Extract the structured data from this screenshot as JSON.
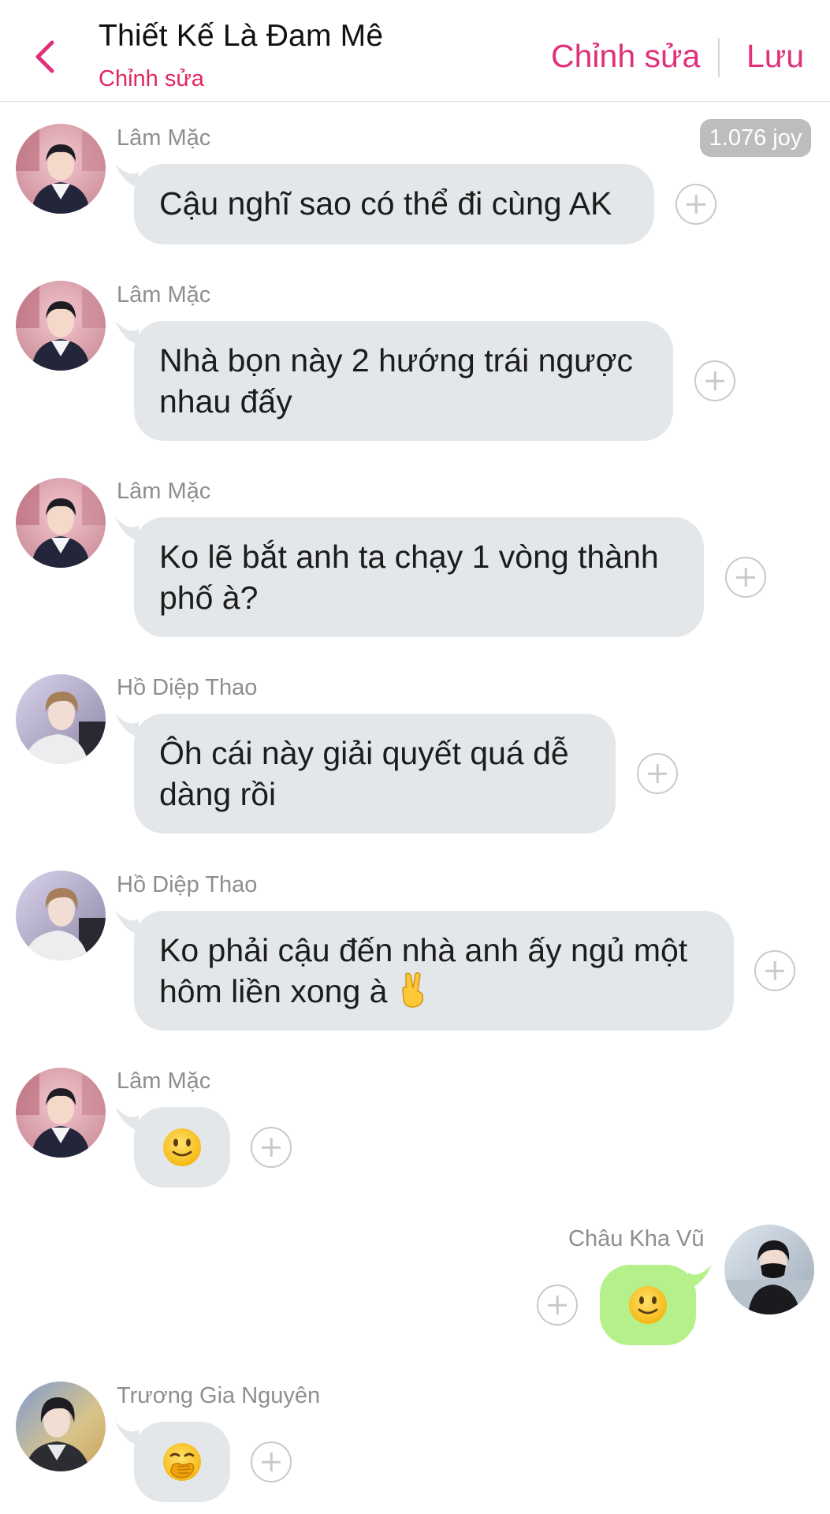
{
  "header": {
    "title": "Thiết Kế Là Đam Mê",
    "subtitle": "Chỉnh sửa",
    "edit_label": "Chỉnh sửa",
    "save_label": "Lưu",
    "back_icon": "chevron-left-icon"
  },
  "coin_badge": "1.076 joy",
  "colors": {
    "accent": "#e0307a",
    "subtitle": "#e0285e",
    "bubble_gray": "#e4e7ea",
    "bubble_green": "#b6f08a"
  },
  "messages": [
    {
      "sender": "Lâm Mặc",
      "text": "Cậu nghĩ sao có thể đi cùng AK"
    },
    {
      "sender": "Lâm Mặc",
      "text": "Nhà bọn này 2 hướng trái ngược nhau đấy"
    },
    {
      "sender": "Lâm Mặc",
      "text": "Ko lẽ bắt anh ta chạy 1 vòng thành phố à?"
    },
    {
      "sender": "Hồ Diệp Thao",
      "text": "Ôh cái này giải quyết quá dễ dàng rồi"
    },
    {
      "sender": "Hồ Diệp Thao",
      "text": "Ko phải cậu đến nhà anh ấy ngủ một hôm liền xong à",
      "emoji": "victory-hand-emoji"
    },
    {
      "sender": "Lâm Mặc",
      "emoji": "slightly-smiling-face-emoji"
    },
    {
      "sender": "Châu Kha Vũ",
      "emoji": "slightly-smiling-face-emoji",
      "own": true
    },
    {
      "sender": "Trương Gia Nguyên",
      "emoji": "face-with-hand-over-mouth-emoji"
    }
  ]
}
